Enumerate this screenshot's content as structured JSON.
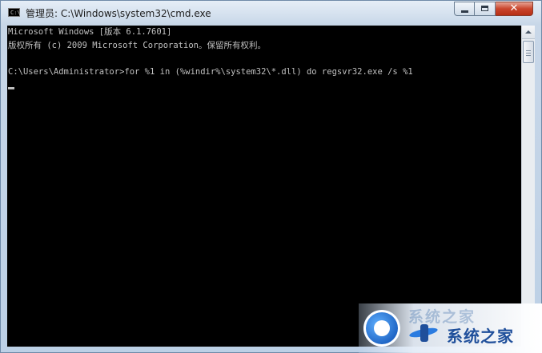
{
  "window": {
    "title": "管理员: C:\\Windows\\system32\\cmd.exe",
    "app_icon_text": "C:\\",
    "controls": {
      "minimize": "minimize",
      "maximize": "maximize",
      "close": "✕"
    }
  },
  "console": {
    "lines": [
      "Microsoft Windows [版本 6.1.7601]",
      "版权所有 (c) 2009 Microsoft Corporation。保留所有权利。",
      "",
      "C:\\Users\\Administrator>for %1 in (%windir%\\system32\\*.dll) do regsvr32.exe /s %1"
    ],
    "background": "#000000",
    "foreground": "#c0c0c0"
  },
  "watermark": {
    "faded_text": "系统之家",
    "text": "系统之家"
  },
  "colors": {
    "close_button": "#c9452c",
    "brand": "#1f4f9b"
  }
}
